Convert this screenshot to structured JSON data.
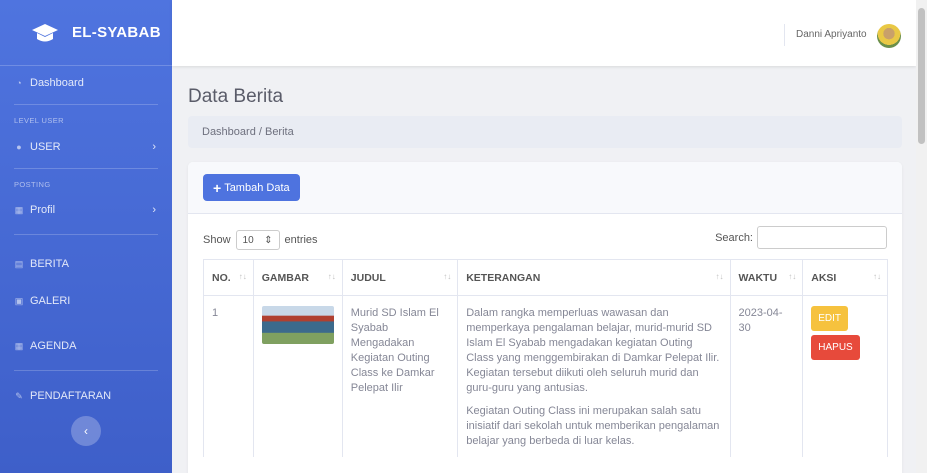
{
  "brand": {
    "name": "EL-SYABAB",
    "icon": "graduation-cap-icon"
  },
  "sidebar": {
    "dashboard": "Dashboard",
    "level_user_heading": "LEVEL USER",
    "user": "USER",
    "posting_heading": "POSTING",
    "profil": "Profil",
    "berita": "BERITA",
    "galeri": "GALERI",
    "agenda": "AGENDA",
    "pendaftaran": "PENDAFTARAN"
  },
  "topbar": {
    "user_name": "Danni Apriyanto"
  },
  "page": {
    "title": "Data Berita",
    "breadcrumb": "Dashboard / Berita"
  },
  "card": {
    "add_button": "Tambah Data"
  },
  "table_controls": {
    "show_label": "Show",
    "entries_value": "10",
    "entries_label": "entries",
    "search_label": "Search:"
  },
  "table": {
    "headers": [
      "NO.",
      "GAMBAR",
      "JUDUL",
      "KETERANGAN",
      "WAKTU",
      "AKSI"
    ],
    "rows": [
      {
        "no": "1",
        "judul": "Murid SD Islam El Syabab Mengadakan Kegiatan Outing Class ke Damkar Pelepat Ilir",
        "keterangan_1": "Dalam rangka memperluas wawasan dan memperkaya pengalaman belajar, murid-murid SD Islam El Syabab mengadakan kegiatan Outing Class yang menggembirakan di Damkar Pelepat Ilir. Kegiatan tersebut diikuti oleh seluruh murid dan guru-guru yang antusias.",
        "keterangan_2": "Kegiatan Outing Class ini merupakan salah satu inisiatif dari sekolah untuk memberikan pengalaman belajar yang berbeda di luar kelas.",
        "waktu": "2023-04-30",
        "edit": "EDIT",
        "hapus": "HAPUS"
      }
    ]
  },
  "colors": {
    "sidebar": "#4e73df",
    "primary": "#4e73df",
    "warning": "#f6c23e",
    "danger": "#e74a3b"
  }
}
